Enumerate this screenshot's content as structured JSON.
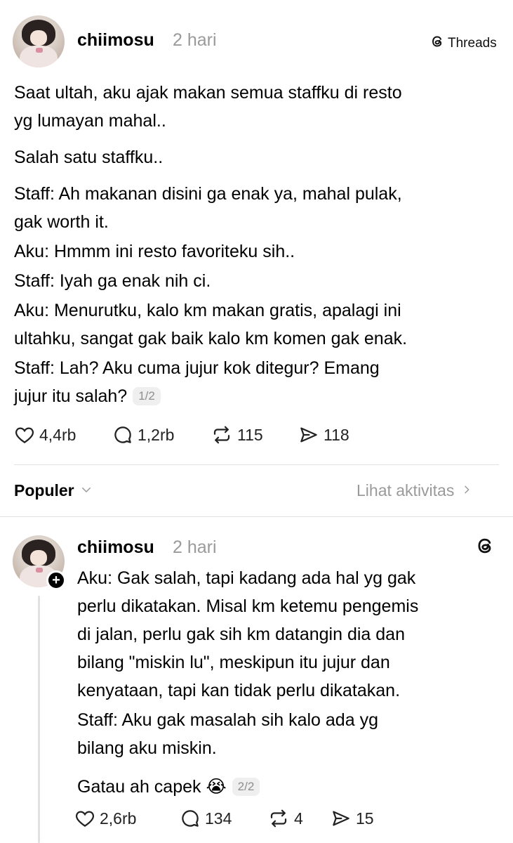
{
  "post1": {
    "username": "chiimosu",
    "time": "2 hari",
    "brand_label": "Threads",
    "paragraphs": [
      [
        "Saat ultah, aku ajak makan semua staffku di resto",
        "yg lumayan mahal.."
      ],
      [
        "Salah satu staffku.."
      ],
      [
        "Staff: Ah makanan disini ga enak ya, mahal pulak,",
        "gak worth it."
      ],
      [
        "Aku: Hmmm ini resto favoriteku sih.."
      ],
      [
        "Staff: Iyah ga enak nih ci."
      ],
      [
        "Aku: Menurutku, kalo km makan gratis, apalagi ini",
        "ultahku, sangat gak baik kalo km komen gak enak."
      ],
      [
        "Staff: Lah? Aku cuma jujur kok ditegur? Emang",
        "jujur itu salah?"
      ]
    ],
    "page_indicator": "1/2",
    "likes": "4,4rb",
    "comments": "1,2rb",
    "reposts": "115",
    "shares": "118"
  },
  "filter": {
    "sort_label": "Populer",
    "activity_label": "Lihat aktivitas"
  },
  "post2": {
    "username": "chiimosu",
    "time": "2 hari",
    "paragraphs": [
      [
        "Aku: Gak salah, tapi kadang ada hal yg gak",
        "perlu dikatakan. Misal km ketemu pengemis",
        "di jalan, perlu gak sih km datangin dia dan",
        "bilang \"miskin lu\", meskipun itu jujur dan",
        "kenyataan, tapi kan tidak perlu dikatakan."
      ],
      [
        "Staff: Aku gak masalah sih kalo ada yg",
        "bilang aku miskin."
      ]
    ],
    "closing": "Gatau ah capek 😭",
    "page_indicator": "2/2",
    "likes": "2,6rb",
    "comments": "134",
    "reposts": "4",
    "shares": "15"
  }
}
